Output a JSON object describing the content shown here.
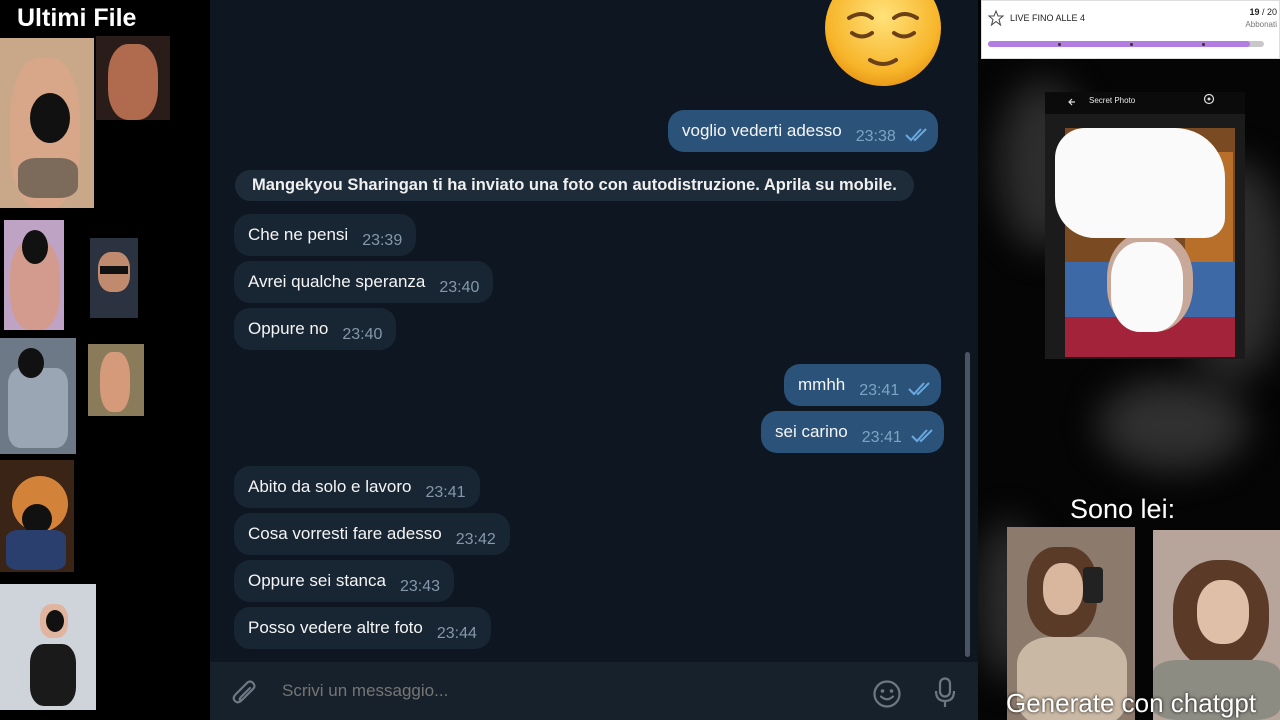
{
  "left_panel": {
    "title": "Ultimi File"
  },
  "chat": {
    "service_message": "Mangekyou Sharingan ti ha inviato una foto con autodistruzione. Aprila su mobile.",
    "messages": [
      {
        "direction": "out",
        "text": "voglio vederti adesso",
        "time": "23:38"
      },
      {
        "direction": "in",
        "text": "Che ne pensi",
        "time": "23:39"
      },
      {
        "direction": "in",
        "text": "Avrei qualche speranza",
        "time": "23:40"
      },
      {
        "direction": "in",
        "text": "Oppure no",
        "time": "23:40"
      },
      {
        "direction": "out",
        "text": "mmhh",
        "time": "23:41"
      },
      {
        "direction": "out",
        "text": "sei carino",
        "time": "23:41"
      },
      {
        "direction": "in",
        "text": "Abito da solo e lavoro",
        "time": "23:41"
      },
      {
        "direction": "in",
        "text": "Cosa vorresti fare adesso",
        "time": "23:42"
      },
      {
        "direction": "in",
        "text": "Oppure sei stanca",
        "time": "23:43"
      },
      {
        "direction": "in",
        "text": "Posso vedere altre foto",
        "time": "23:44"
      }
    ],
    "composer": {
      "placeholder": "Scrivi un messaggio..."
    },
    "colors": {
      "background": "#0e1621",
      "incoming_bubble": "#182533",
      "outgoing_bubble": "#2b5278",
      "check_color": "#6aa8e0"
    }
  },
  "right_panel": {
    "goal": {
      "title": "LIVE FINO ALLE 4",
      "count": "19",
      "count_total": "/ 20",
      "subtitle": "Abbonati",
      "progress": 0.95,
      "accent": "#b27ce0"
    },
    "phone_screen_title": "Secret Photo",
    "caption_top": "Sono lei:",
    "caption_bottom": "Generate con chatgpt"
  }
}
